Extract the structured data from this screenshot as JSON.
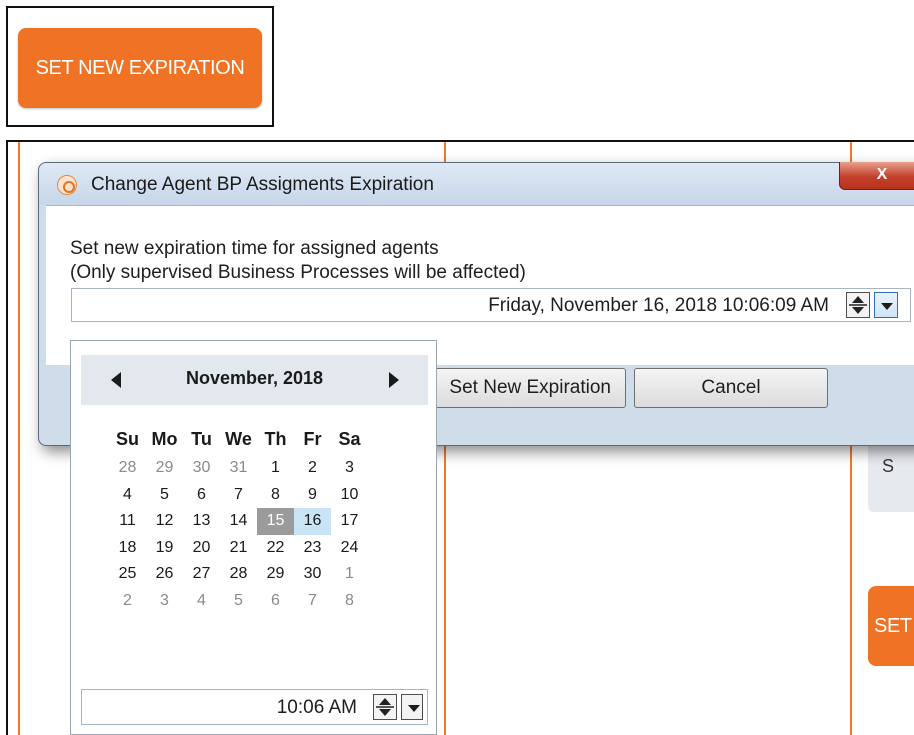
{
  "top_button": {
    "label": "SET NEW EXPIRATION"
  },
  "background": {
    "panel_text": "S",
    "partial_button_label": "SET"
  },
  "dialog": {
    "title": "Change Agent BP Assigments Expiration",
    "close_label": "X",
    "prompt_line1": "Set new expiration time for assigned agents",
    "prompt_line2": "(Only supervised Business Processes will be affected)",
    "datetime_value": "Friday, November 16, 2018 10:06:09 AM",
    "set_button": "Set New Expiration",
    "cancel_button": "Cancel"
  },
  "calendar": {
    "month_title": "November, 2018",
    "weekdays": [
      "Su",
      "Mo",
      "Tu",
      "We",
      "Th",
      "Fr",
      "Sa"
    ],
    "weeks": [
      [
        "28",
        "29",
        "30",
        "31",
        "1",
        "2",
        "3"
      ],
      [
        "4",
        "5",
        "6",
        "7",
        "8",
        "9",
        "10"
      ],
      [
        "11",
        "12",
        "13",
        "14",
        "15",
        "16",
        "17"
      ],
      [
        "18",
        "19",
        "20",
        "21",
        "22",
        "23",
        "24"
      ],
      [
        "25",
        "26",
        "27",
        "28",
        "29",
        "30",
        "1"
      ],
      [
        "2",
        "3",
        "4",
        "5",
        "6",
        "7",
        "8"
      ]
    ],
    "other_month_days": {
      "first_week_leading": 4,
      "fifth_week_trailing": 1,
      "sixth_week_all": true
    },
    "today": "15",
    "selected": "16",
    "time_value": "10:06 AM"
  },
  "colors": {
    "accent_orange": "#f07224",
    "today_bg": "#9b9b9b",
    "selected_bg": "#c9e5f5",
    "titlebar": "#cfdcea"
  }
}
